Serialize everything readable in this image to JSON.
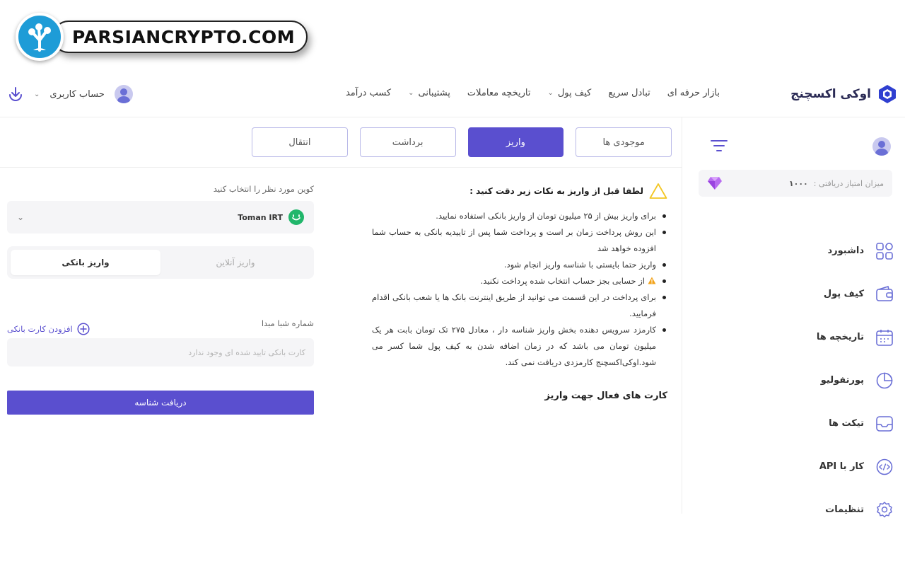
{
  "watermark": {
    "text": "PARSIANCRYPTO.COM"
  },
  "header": {
    "brand": "اوکی اکسچنج",
    "nav": [
      {
        "label": "بازار حرفه ای",
        "dropdown": false
      },
      {
        "label": "تبادل سریع",
        "dropdown": false
      },
      {
        "label": "کیف پول",
        "dropdown": true
      },
      {
        "label": "تاریخچه معاملات",
        "dropdown": false
      },
      {
        "label": "پشتیبانی",
        "dropdown": true
      },
      {
        "label": "کسب درآمد",
        "dropdown": false
      }
    ],
    "account_label": "حساب کاربری"
  },
  "sidebar": {
    "score_label": "میزان امتیاز دریافتی :",
    "score_value": "۱۰۰۰",
    "menu": [
      {
        "label": "داشبورد",
        "icon": "dashboard-icon"
      },
      {
        "label": "کیف پول",
        "icon": "wallet-icon"
      },
      {
        "label": "تاریخچه ها",
        "icon": "calendar-icon"
      },
      {
        "label": "پورتفولیو",
        "icon": "pie-chart-icon"
      },
      {
        "label": "تیکت ها",
        "icon": "inbox-icon"
      },
      {
        "label": "کار با API",
        "icon": "code-icon"
      },
      {
        "label": "تنظیمات",
        "icon": "gear-icon"
      }
    ]
  },
  "tabs": [
    {
      "label": "موجودی ها",
      "active": false
    },
    {
      "label": "واریز",
      "active": true
    },
    {
      "label": "برداشت",
      "active": false
    },
    {
      "label": "انتقال",
      "active": false
    }
  ],
  "notes": {
    "title": "لطفا قبل از واریز به نکات زیر دقت کنید :",
    "items": [
      "برای واریز بیش از ۲۵ میلیون تومان از واریز بانکی استفاده نمایید.",
      "این روش پرداخت زمان بر است و پرداخت شما پس از تاییدیه بانکی به حساب شما افزوده خواهد شد",
      "واریز حتما بایستی با شناسه واریز انجام شود.",
      "از حسابی بجز حساب انتخاب شده پرداخت نکنید.",
      "برای پرداخت در این قسمت می توانید از طریق اینترنت بانک ها یا شعب بانکی اقدام فرمایید.",
      "کارمزد سرویس دهنده بخش واریز شناسه دار ، معادل ۲۷۵ تک تومان بابت هر یک میلیون تومان می باشد که در زمان اضافه شدن به کیف پول شما کسر می شود.اوکی‌اکسچنج کارمزدی دریافت نمی کند."
    ],
    "cards_title": "کارت های فعال جهت واریز"
  },
  "form": {
    "coin_label": "کوین مورد نظر را انتخاب کنید",
    "coin_selected": "Toman IRT",
    "seg_online": "واریز آنلاین",
    "seg_bank": "واریز بانکی",
    "iban_label": "شماره شبا مبدا",
    "add_card": "افزودن کارت بانکی",
    "iban_placeholder": "کارت بانکی تایید شده ای وجود ندارد",
    "submit": "دریافت شناسه"
  },
  "colors": {
    "accent": "#5a4fcf",
    "toman": "#21b66b",
    "watermark": "#1e9cd7"
  }
}
